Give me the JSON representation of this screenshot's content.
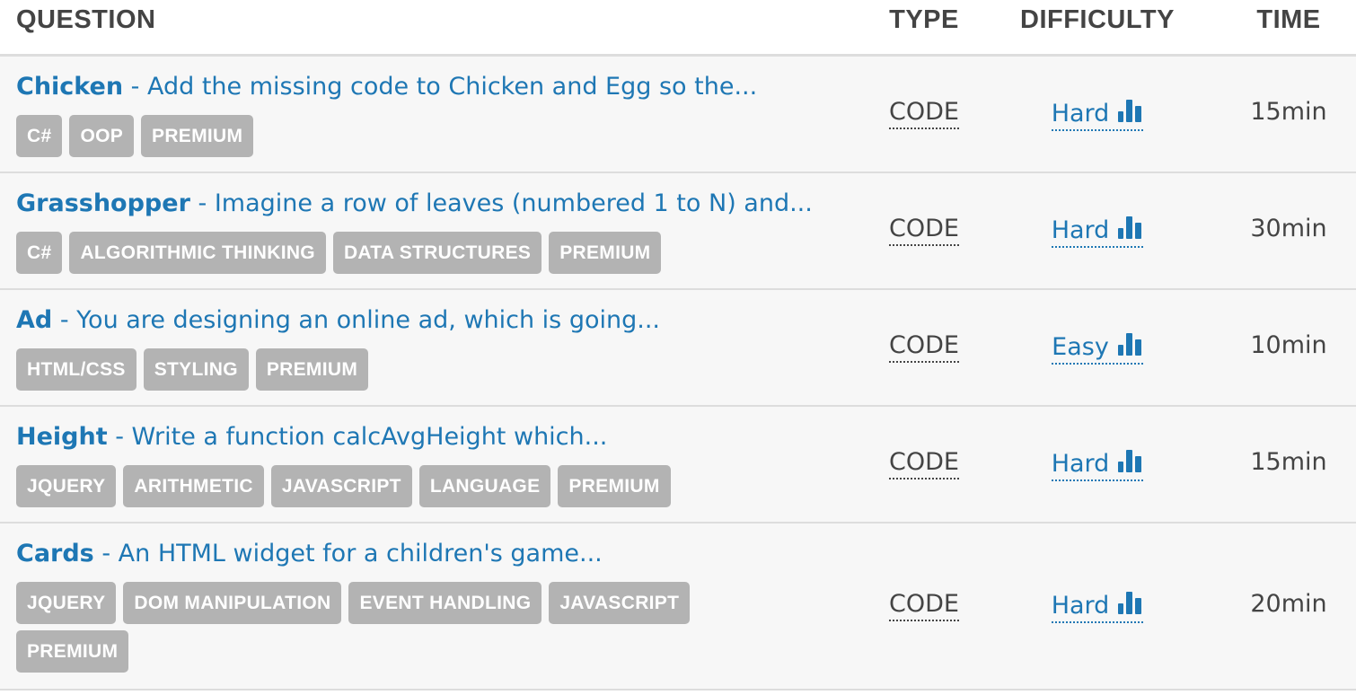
{
  "headers": {
    "question": "QUESTION",
    "type": "TYPE",
    "difficulty": "DIFFICULTY",
    "time": "TIME"
  },
  "colors": {
    "link": "#1e77b4",
    "tag_bg": "#b3b3b3",
    "row_bg": "#f7f7f7"
  },
  "icons": {
    "difficulty": "bar-chart-icon"
  },
  "rows": [
    {
      "title": "Chicken",
      "description": " - Add the missing code to Chicken and Egg so the...",
      "tags": [
        "C#",
        "OOP",
        "PREMIUM"
      ],
      "type": "CODE",
      "difficulty": "Hard",
      "time": "15min"
    },
    {
      "title": "Grasshopper",
      "description": " - Imagine a row of leaves (numbered 1 to N) and...",
      "tags": [
        "C#",
        "ALGORITHMIC THINKING",
        "DATA STRUCTURES",
        "PREMIUM"
      ],
      "type": "CODE",
      "difficulty": "Hard",
      "time": "30min"
    },
    {
      "title": "Ad",
      "description": " - You are designing an online ad, which is going...",
      "tags": [
        "HTML/CSS",
        "STYLING",
        "PREMIUM"
      ],
      "type": "CODE",
      "difficulty": "Easy",
      "time": "10min"
    },
    {
      "title": "Height",
      "description": " - Write a function calcAvgHeight which...",
      "tags": [
        "JQUERY",
        "ARITHMETIC",
        "JAVASCRIPT",
        "LANGUAGE",
        "PREMIUM"
      ],
      "type": "CODE",
      "difficulty": "Hard",
      "time": "15min"
    },
    {
      "title": "Cards",
      "description": " - An HTML widget for a children's game...",
      "tags": [
        "JQUERY",
        "DOM MANIPULATION",
        "EVENT HANDLING",
        "JAVASCRIPT",
        "PREMIUM"
      ],
      "type": "CODE",
      "difficulty": "Hard",
      "time": "20min"
    }
  ]
}
